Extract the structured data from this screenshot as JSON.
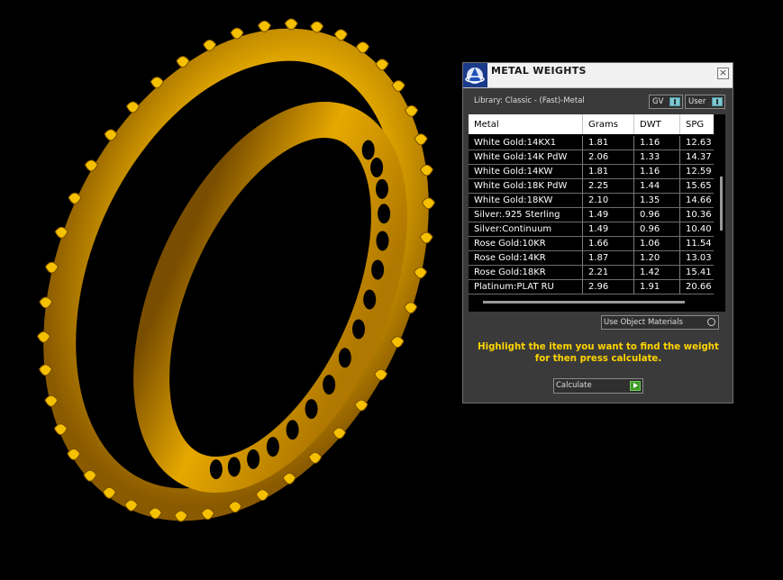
{
  "panel": {
    "title": "METAL WEIGHTS",
    "close_icon": "close-icon",
    "library_label": "Library: Classic - (Fast)-Metal",
    "gv_label": "GV",
    "user_label": "User",
    "table": {
      "columns": [
        "Metal",
        "Grams",
        "DWT",
        "SPG"
      ],
      "rows": [
        {
          "metal": "White Gold:14KX1",
          "grams": "1.81",
          "dwt": "1.16",
          "spg": "12.63"
        },
        {
          "metal": "White Gold:14K PdW",
          "grams": "2.06",
          "dwt": "1.33",
          "spg": "14.37"
        },
        {
          "metal": "White Gold:14KW",
          "grams": "1.81",
          "dwt": "1.16",
          "spg": "12.59"
        },
        {
          "metal": "White Gold:18K PdW",
          "grams": "2.25",
          "dwt": "1.44",
          "spg": "15.65"
        },
        {
          "metal": "White Gold:18KW",
          "grams": "2.10",
          "dwt": "1.35",
          "spg": "14.66"
        },
        {
          "metal": "Silver:.925 Sterling",
          "grams": "1.49",
          "dwt": "0.96",
          "spg": "10.36"
        },
        {
          "metal": "Silver:Continuum",
          "grams": "1.49",
          "dwt": "0.96",
          "spg": "10.40"
        },
        {
          "metal": "Rose Gold:10KR",
          "grams": "1.66",
          "dwt": "1.06",
          "spg": "11.54"
        },
        {
          "metal": "Rose Gold:14KR",
          "grams": "1.87",
          "dwt": "1.20",
          "spg": "13.03"
        },
        {
          "metal": "Rose Gold:18KR",
          "grams": "2.21",
          "dwt": "1.42",
          "spg": "15.41"
        },
        {
          "metal": "Platinum:PLAT RU",
          "grams": "2.96",
          "dwt": "1.91",
          "spg": "20.66"
        }
      ]
    },
    "use_object_materials": "Use Object Materials",
    "instruction": "Highlight the item you want to find the weight for then press calculate.",
    "calculate_label": "Calculate"
  },
  "colors": {
    "ring_gold": "#f0b400",
    "instruction_yellow": "#ffd400",
    "panel_bg": "#3a3a3a",
    "toggle_cyan": "#7fc8cf",
    "calculate_green": "#3f9a2a"
  }
}
